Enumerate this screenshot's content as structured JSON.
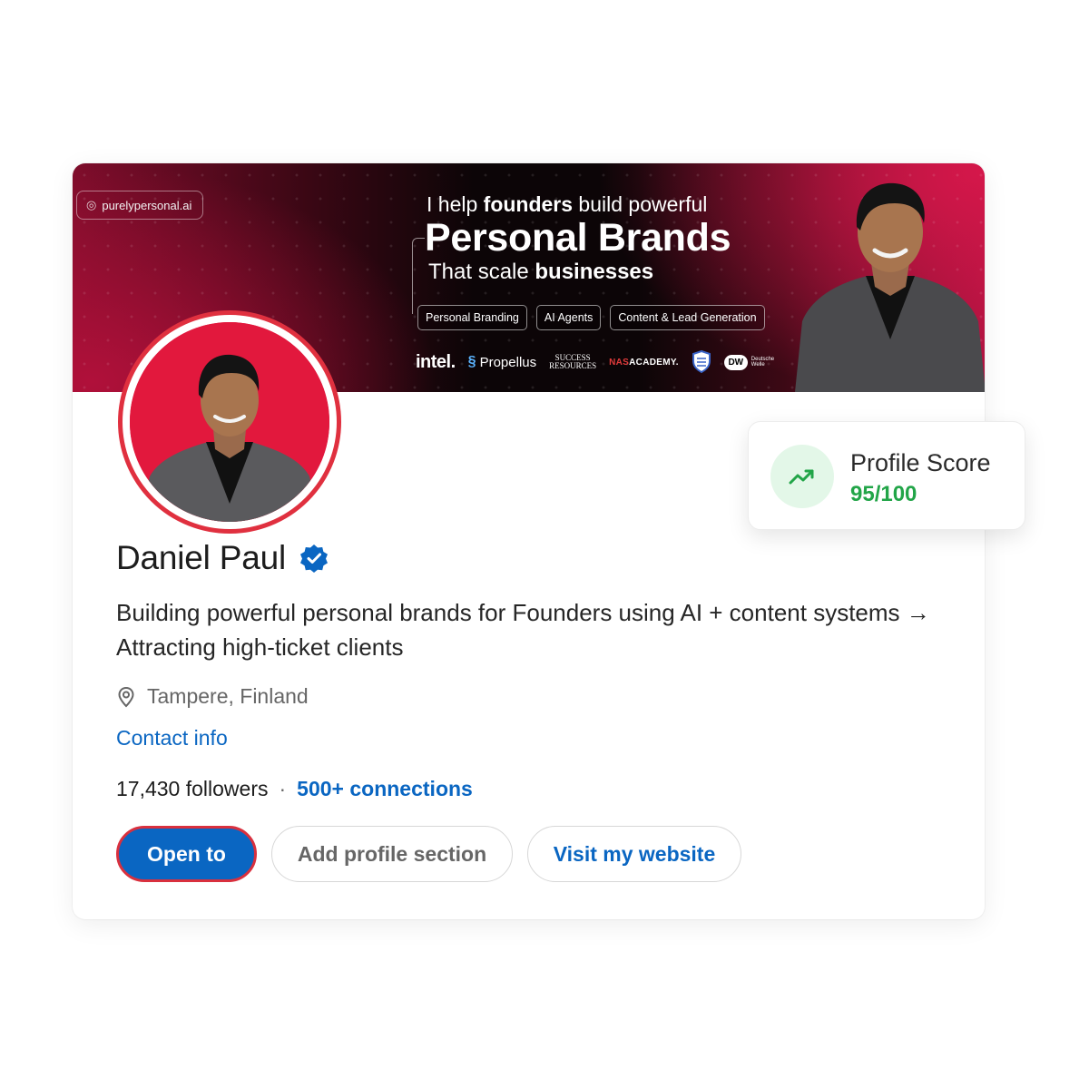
{
  "banner": {
    "website": "purelypersonal.ai",
    "line1_pre": "I help ",
    "line1_bold": "founders",
    "line1_post": " build powerful",
    "line2": "Personal Brands",
    "line3_pre": "That scale ",
    "line3_bold": "businesses",
    "tags": [
      "Personal Branding",
      "AI Agents",
      "Content & Lead Generation"
    ],
    "logos": {
      "intel": "intel.",
      "propellus": "Propellus",
      "success_top": "SUCCESS",
      "success_bottom": "RESOURCES",
      "nas_prefix": "NAS",
      "nas_suffix": "ACADEMY."
    }
  },
  "profile": {
    "name": "Daniel Paul",
    "headline": "Building powerful personal brands for Founders using AI + content systems → Attracting high-ticket clients",
    "location": "Tampere, Finland",
    "contact_info": "Contact info",
    "followers": "17,430 followers",
    "separator": "·",
    "connections": "500+ connections"
  },
  "actions": {
    "open_to": "Open to",
    "add_section": "Add profile section",
    "visit_website": "Visit my website"
  },
  "profile_score": {
    "title": "Profile Score",
    "value": "95/100",
    "score": 95,
    "max": 100
  },
  "colors": {
    "brand_blue": "#0a66c2",
    "banner_red": "#d4174a",
    "avatar_ring": "#e0303f",
    "score_green": "#22a548"
  },
  "icons": {
    "verified": "verified-badge-icon",
    "location": "location-pin-icon",
    "score": "trending-up-icon",
    "website": "globe-icon"
  }
}
